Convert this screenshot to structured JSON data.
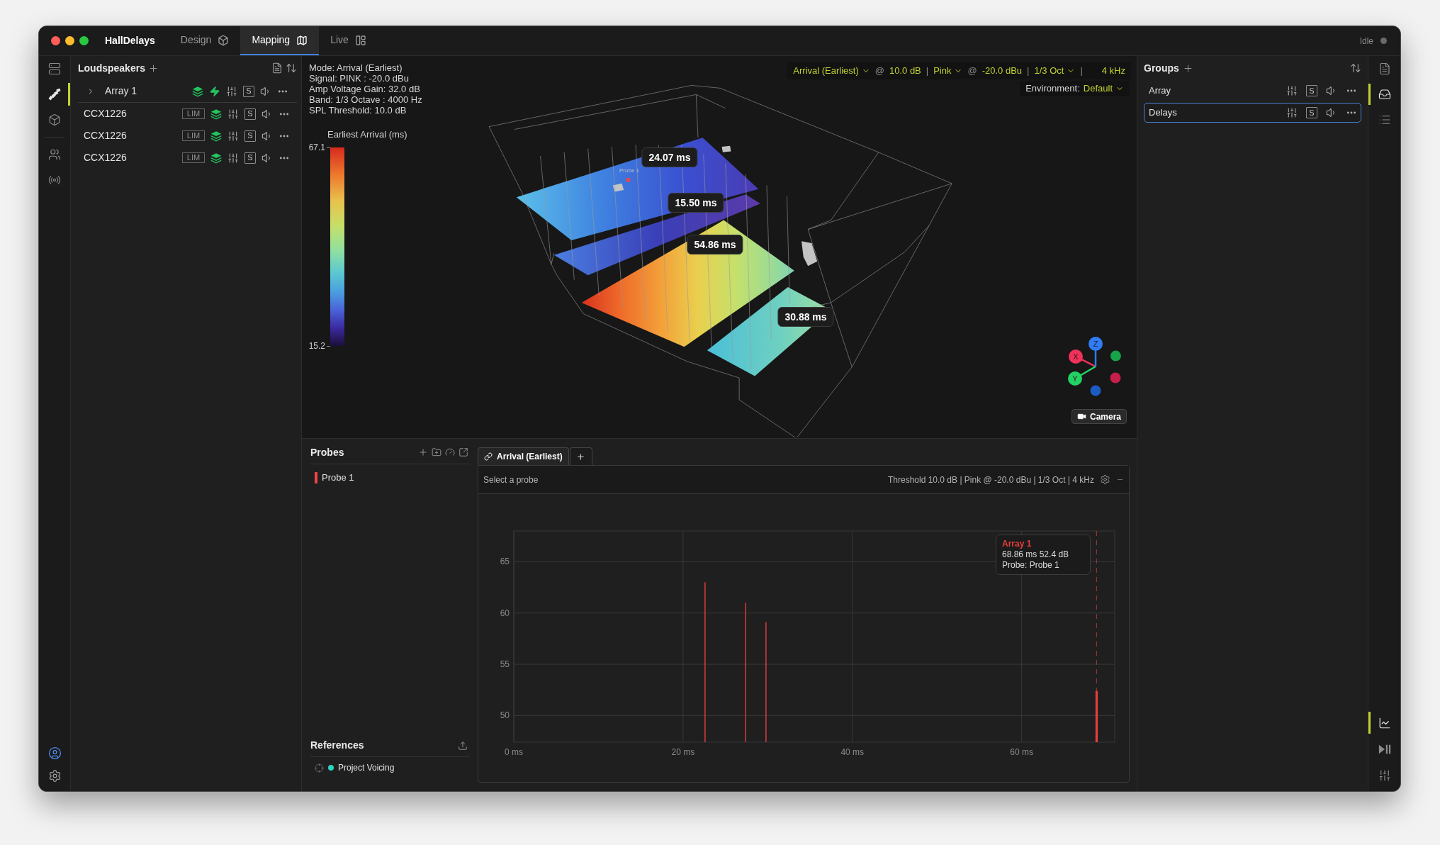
{
  "window": {
    "app_title": "HallDelays",
    "tabs": [
      {
        "label": "Design",
        "selected": false
      },
      {
        "label": "Mapping",
        "selected": true
      },
      {
        "label": "Live",
        "selected": false
      }
    ],
    "status": "Idle"
  },
  "left_rail": {
    "items": [
      {
        "selected": false
      },
      {
        "selected": true
      },
      {
        "selected": false
      },
      {
        "selected": false
      },
      {
        "selected": false
      }
    ]
  },
  "loudspeakers": {
    "title": "Loudspeakers",
    "rows": [
      {
        "kind": "array",
        "name": "Array 1",
        "expanded": false,
        "solo": "S"
      },
      {
        "kind": "speaker",
        "name": "CCX1226",
        "limiter": "LIM",
        "solo": "S"
      },
      {
        "kind": "speaker",
        "name": "CCX1226",
        "limiter": "LIM",
        "solo": "S"
      },
      {
        "kind": "speaker",
        "name": "CCX1226",
        "limiter": "LIM",
        "solo": "S"
      }
    ]
  },
  "scene": {
    "info": [
      "Mode: Arrival (Earliest)",
      "Signal: PINK : -20.0 dBu",
      "Amp Voltage Gain: 32.0 dB",
      "Band: 1/3 Octave : 4000 Hz",
      "SPL Threshold: 10.0 dB"
    ],
    "legend": {
      "title": "Earliest Arrival (ms)",
      "max": "67.1",
      "min": "15.2"
    },
    "toolbar": [
      {
        "kind": "dropdown",
        "text": "Arrival (Earliest)"
      },
      {
        "kind": "symbol",
        "text": "@"
      },
      {
        "kind": "value",
        "text": "10.0 dB"
      },
      {
        "kind": "symbol",
        "text": "|"
      },
      {
        "kind": "dropdown",
        "text": "Pink"
      },
      {
        "kind": "symbol",
        "text": "@"
      },
      {
        "kind": "value",
        "text": "-20.0 dBu"
      },
      {
        "kind": "symbol",
        "text": "|"
      },
      {
        "kind": "dropdown",
        "text": "1/3 Oct"
      },
      {
        "kind": "symbol",
        "text": "|"
      },
      {
        "kind": "value",
        "text": "4 kHz"
      }
    ],
    "environment": {
      "label": "Environment:",
      "value": "Default"
    },
    "arrival_labels": [
      "24.07 ms",
      "15.50 ms",
      "54.86 ms",
      "30.88 ms"
    ],
    "probe_label": "Probe 1",
    "axes": [
      {
        "label": "X",
        "color": "#f2315a"
      },
      {
        "label": "Y",
        "color": "#22d364"
      },
      {
        "label": "Z",
        "color": "#2f7cf6"
      }
    ],
    "negative_axes": [
      {
        "color": "#c81e4a"
      },
      {
        "color": "#16a34a"
      },
      {
        "color": "#1d5bc4"
      }
    ],
    "camera_button": "Camera"
  },
  "probes": {
    "title": "Probes",
    "items": [
      {
        "name": "Probe 1",
        "color": "#ef4444"
      }
    ]
  },
  "references": {
    "title": "References",
    "items": [
      {
        "name": "Project Voicing",
        "color": "#2dd4bf"
      }
    ]
  },
  "analysis": {
    "tabs": [
      {
        "label": "Arrival (Earliest)",
        "selected": true
      }
    ],
    "hint": "Select a probe",
    "settings": "Threshold 10.0 dB | Pink @ -20.0 dBu | 1/3 Oct | 4 kHz",
    "chart_data": {
      "type": "bar",
      "x": [
        22.6,
        27.4,
        29.8,
        68.86
      ],
      "series": [
        {
          "color": "#e53e3e",
          "values": [
            63.0,
            61.0,
            59.1,
            52.4
          ]
        }
      ],
      "xlim": [
        0,
        71
      ],
      "ylim": [
        47.4,
        68
      ],
      "xticks": [
        {
          "value": 0,
          "label": "0 ms"
        },
        {
          "value": 20,
          "label": "20 ms"
        },
        {
          "value": 40,
          "label": "40 ms"
        },
        {
          "value": 60,
          "label": "60 ms"
        }
      ],
      "yticks": [
        50,
        55,
        60,
        65
      ],
      "grid": true,
      "ref_lines": [
        {
          "axis": "x",
          "value": 68.86
        }
      ]
    },
    "tooltip": {
      "title": "Array 1",
      "lines": [
        "68.86 ms 52.4 dB",
        "Probe: Probe 1"
      ]
    }
  },
  "groups": {
    "title": "Groups",
    "rows": [
      {
        "name": "Array",
        "solo": "S",
        "selected": false
      },
      {
        "name": "Delays",
        "solo": "S",
        "selected": true
      }
    ]
  },
  "right_rail": {
    "top": [
      {
        "selected": false
      },
      {
        "selected": true
      },
      {
        "selected": false
      }
    ],
    "bottom": [
      {
        "selected": true
      },
      {
        "selected": false
      },
      {
        "selected": false
      }
    ]
  }
}
